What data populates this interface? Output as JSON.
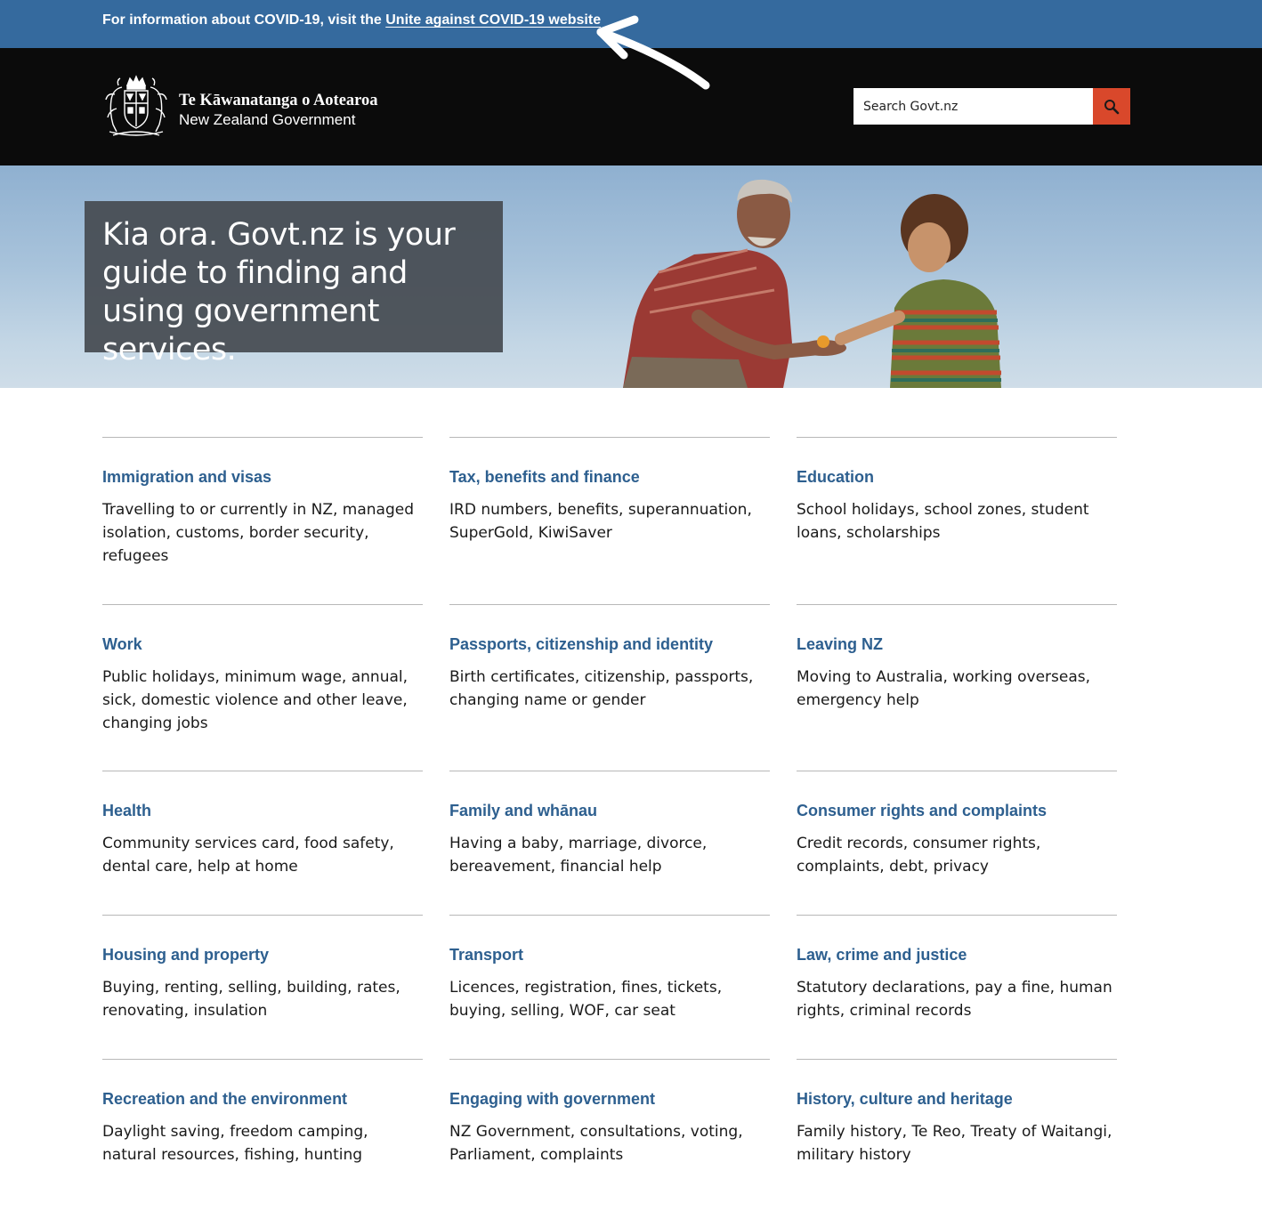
{
  "covid_banner": {
    "prefix": "For information about COVID-19, visit the ",
    "link_text": "Unite against COVID-19 website"
  },
  "header": {
    "brand_maori": "Te Kāwanatanga o Aotearoa",
    "brand_english": "New Zealand Government",
    "search_placeholder": "Search Govt.nz",
    "crest_icon": "nz-coat-of-arms-icon",
    "search_icon": "magnifier-icon"
  },
  "hero": {
    "heading": "Kia ora. Govt.nz is your guide to finding and using government services."
  },
  "categories": [
    {
      "title": "Immigration and visas",
      "desc": "Travelling to or currently in NZ, managed isolation, customs, border security, refugees"
    },
    {
      "title": "Tax, benefits and finance",
      "desc": "IRD numbers, benefits, superannuation, SuperGold, KiwiSaver"
    },
    {
      "title": "Education",
      "desc": "School holidays, school zones, student loans, scholarships"
    },
    {
      "title": "Work",
      "desc": "Public holidays, minimum wage, annual, sick, domestic violence and other leave, changing jobs"
    },
    {
      "title": "Passports, citizenship and identity",
      "desc": "Birth certificates, citizenship, passports, changing name or gender"
    },
    {
      "title": "Leaving NZ",
      "desc": "Moving to Australia, working overseas, emergency help"
    },
    {
      "title": "Health",
      "desc": "Community services card, food safety, dental care, help at home"
    },
    {
      "title": "Family and whānau",
      "desc": "Having a baby, marriage, divorce, bereavement, financial help"
    },
    {
      "title": "Consumer rights and complaints",
      "desc": "Credit records, consumer rights, complaints, debt, privacy"
    },
    {
      "title": "Housing and property",
      "desc": "Buying, renting, selling, building, rates, renovating, insulation"
    },
    {
      "title": "Transport",
      "desc": "Licences, registration, fines, tickets, buying, selling, WOF, car seat"
    },
    {
      "title": "Law, crime and justice",
      "desc": "Statutory declarations, pay a fine, human rights, criminal records"
    },
    {
      "title": "Recreation and the environment",
      "desc": "Daylight saving, freedom camping, natural resources, fishing, hunting"
    },
    {
      "title": "Engaging with government",
      "desc": "NZ Government, consultations, voting, Parliament, complaints"
    },
    {
      "title": "History, culture and heritage",
      "desc": "Family history, Te Reo, Treaty of Waitangi, military history"
    }
  ],
  "colors": {
    "covid_bar": "#356a9e",
    "header_bg": "#0b0b0b",
    "search_button": "#d9482b",
    "category_link": "#2d5f8f"
  }
}
